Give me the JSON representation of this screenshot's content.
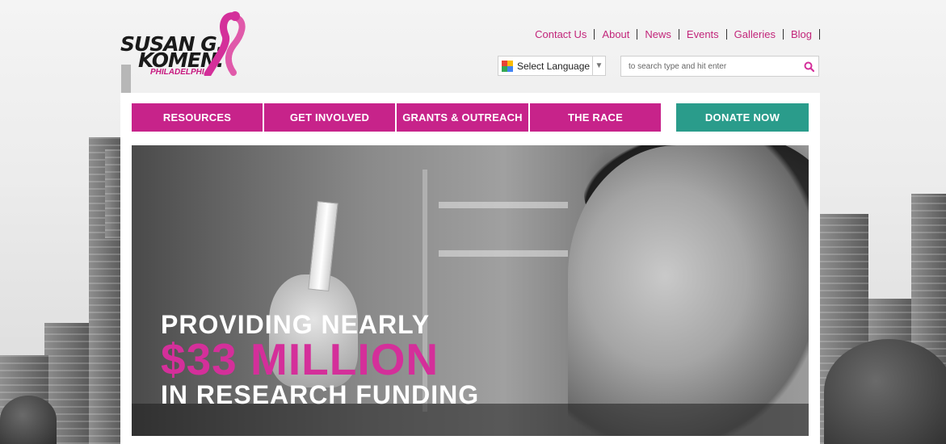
{
  "brand": {
    "line1": "SUSAN G.",
    "line2": "KOMEN.",
    "sub": "PHILADELPHIA",
    "pink": "#c7187f"
  },
  "top_links": [
    "Contact Us",
    "About",
    "News",
    "Events",
    "Galleries",
    "Blog"
  ],
  "language": {
    "label": "Select Language",
    "icon": "google-translate-icon"
  },
  "search": {
    "placeholder": "to search type and hit enter",
    "icon": "search-icon"
  },
  "nav": [
    "RESOURCES",
    "GET INVOLVED",
    "GRANTS & OUTREACH",
    "THE RACE"
  ],
  "donate": "DONATE NOW",
  "colors": {
    "nav": "#c7238a",
    "donate": "#2a9c8b",
    "accent": "#d42f9a"
  },
  "hero": {
    "line1": "PROVIDING NEARLY",
    "line2": "$33 MILLION",
    "line3": "IN RESEARCH FUNDING"
  }
}
